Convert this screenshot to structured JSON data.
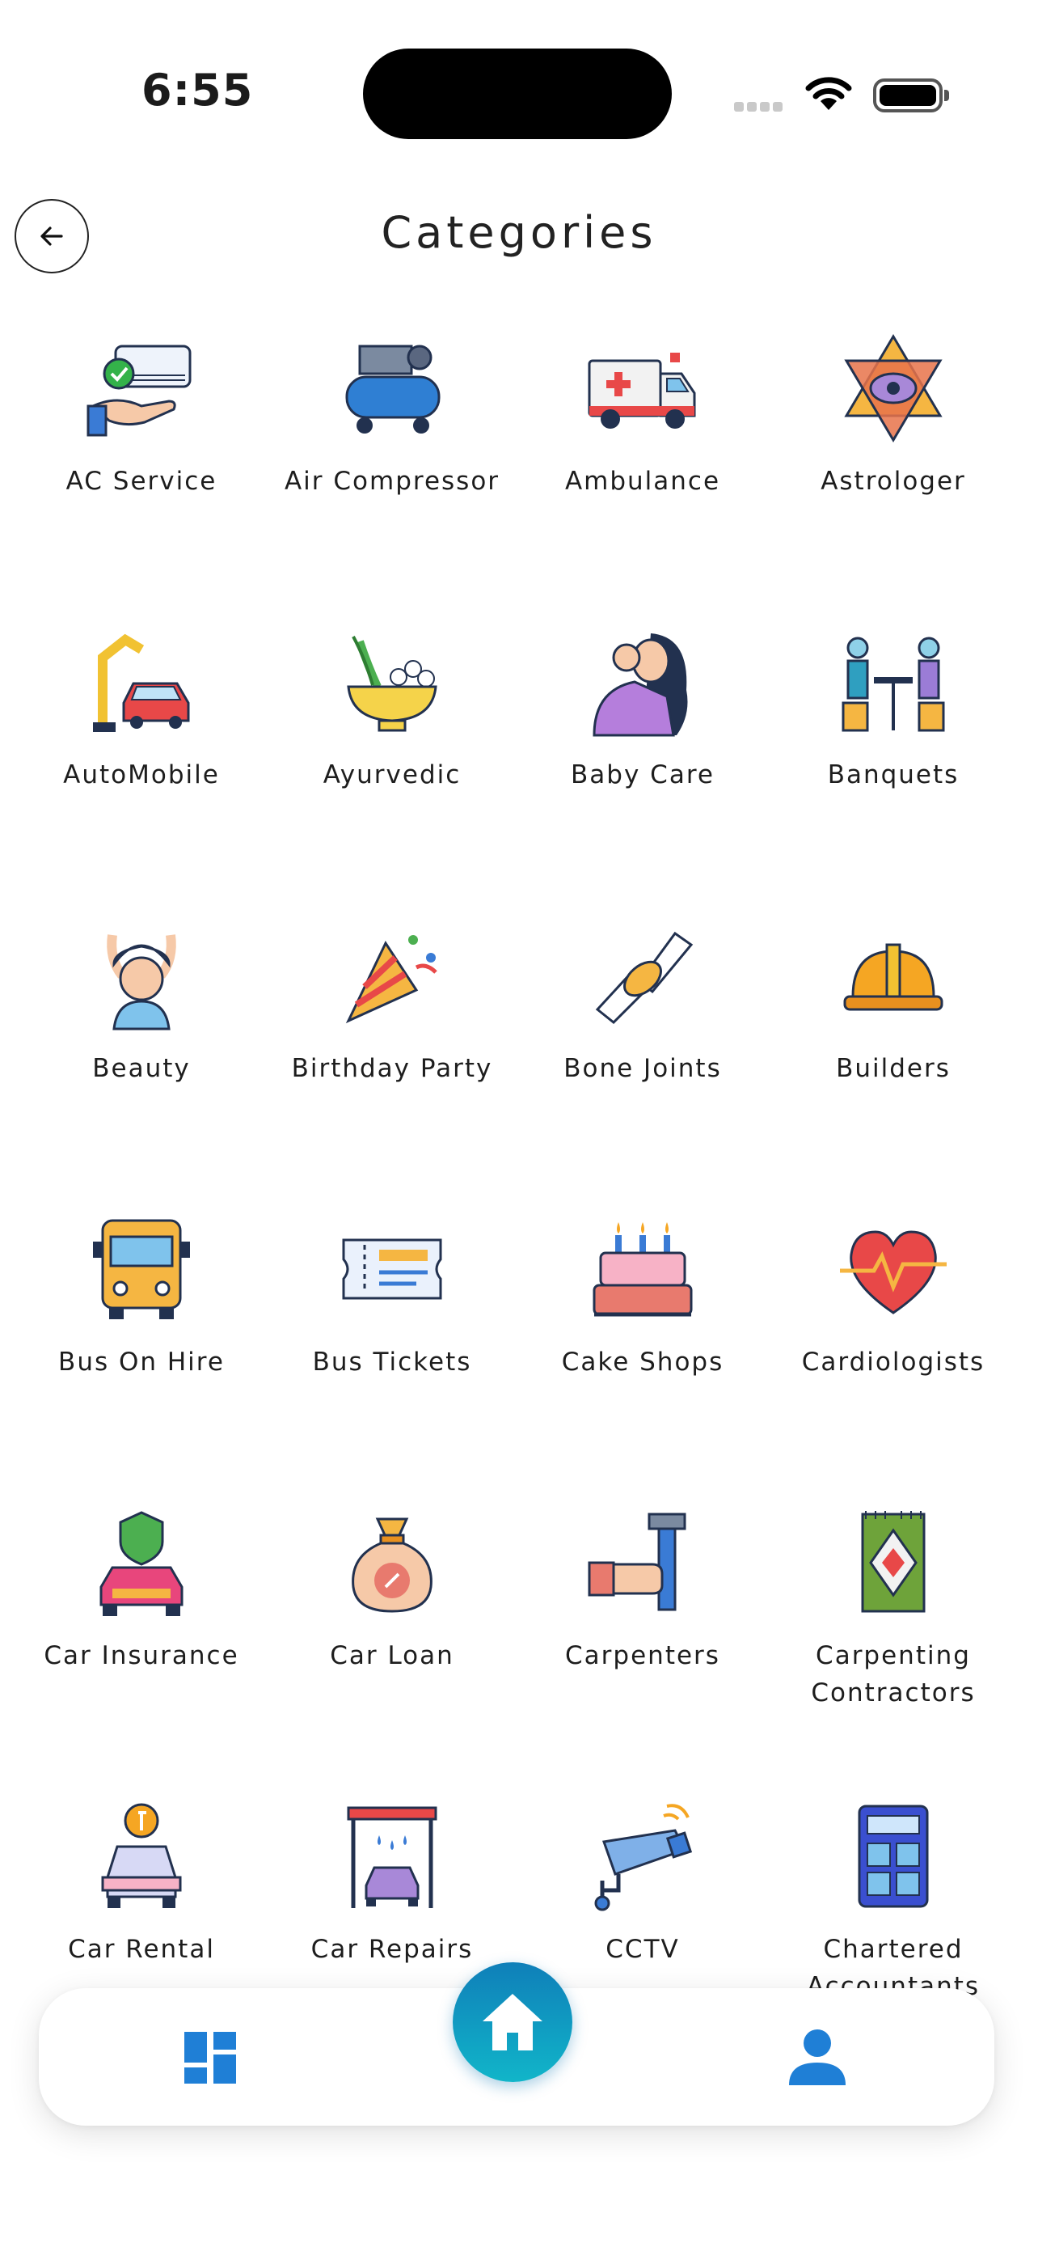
{
  "status_bar": {
    "time": "6:55"
  },
  "header": {
    "title": "Categories"
  },
  "categories": [
    {
      "label": "AC Service",
      "icon": "ac-service-icon"
    },
    {
      "label": "Air Compressor",
      "icon": "air-compressor-icon"
    },
    {
      "label": "Ambulance",
      "icon": "ambulance-icon"
    },
    {
      "label": "Astrologer",
      "icon": "astrologer-icon"
    },
    {
      "label": "AutoMobile",
      "icon": "automobile-icon"
    },
    {
      "label": "Ayurvedic",
      "icon": "ayurvedic-icon"
    },
    {
      "label": "Baby Care",
      "icon": "baby-care-icon"
    },
    {
      "label": "Banquets",
      "icon": "banquets-icon"
    },
    {
      "label": "Beauty",
      "icon": "beauty-icon"
    },
    {
      "label": "Birthday Party",
      "icon": "birthday-party-icon"
    },
    {
      "label": "Bone Joints",
      "icon": "bone-joints-icon"
    },
    {
      "label": "Builders",
      "icon": "builders-icon"
    },
    {
      "label": "Bus On Hire",
      "icon": "bus-on-hire-icon"
    },
    {
      "label": "Bus Tickets",
      "icon": "bus-tickets-icon"
    },
    {
      "label": "Cake Shops",
      "icon": "cake-shops-icon"
    },
    {
      "label": "Cardiologists",
      "icon": "cardiologists-icon"
    },
    {
      "label": "Car Insurance",
      "icon": "car-insurance-icon"
    },
    {
      "label": "Car Loan",
      "icon": "car-loan-icon"
    },
    {
      "label": "Carpenters",
      "icon": "carpenters-icon"
    },
    {
      "label": "Carpenting Contractors",
      "icon": "carpenting-contractors-icon"
    },
    {
      "label": "Car Rental",
      "icon": "car-rental-icon"
    },
    {
      "label": "Car Repairs",
      "icon": "car-repairs-icon"
    },
    {
      "label": "CCTV",
      "icon": "cctv-icon"
    },
    {
      "label": "Chartered Accountants",
      "icon": "chartered-accountants-icon"
    }
  ],
  "bottom_nav": {
    "left": "dashboard-icon",
    "center": "home-icon",
    "right": "profile-icon"
  },
  "colors": {
    "nav_blue": "#1f7fd6",
    "fab_gradient_top": "#0f7fb9",
    "fab_gradient_bottom": "#11b5c9"
  }
}
